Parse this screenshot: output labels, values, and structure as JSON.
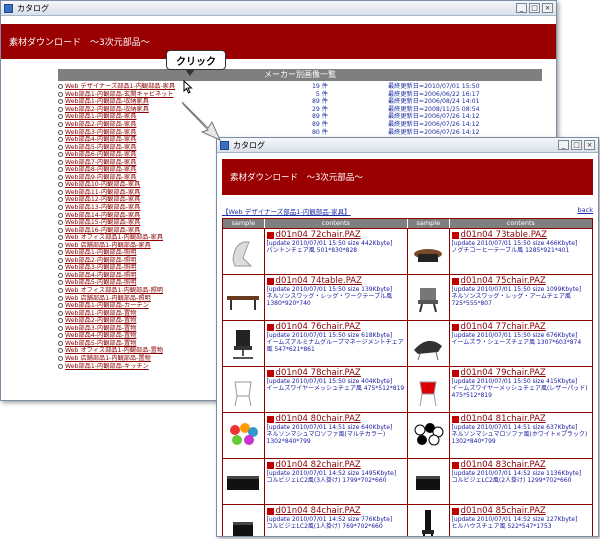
{
  "window1": {
    "title": "カタログ",
    "banner": "素材ダウンロード　～3次元部品～",
    "table_header": "メーカー別画像一覧",
    "rows": [
      {
        "label": "Web デザイナーズ部品1-内観部品-家具",
        "count": "19 件",
        "updated": "最終更新日=2010/07/01 15:50"
      },
      {
        "label": "Web部品1-内観部品-玄関キャビネット",
        "count": "5 件",
        "updated": "最終更新日=2006/06/22 16:17"
      },
      {
        "label": "Web部品1-内観部品-収納家具",
        "count": "89 件",
        "updated": "最終更新日=2006/08/24 14:01"
      },
      {
        "label": "Web部品2-内観部品-収納家具",
        "count": "29 件",
        "updated": "最終更新日=2008/11/25 08:54"
      },
      {
        "label": "Web部品1-内観部品-家具",
        "count": "89 件",
        "updated": "最終更新日=2006/07/26 14:12"
      },
      {
        "label": "Web部品2-内観部品-家具",
        "count": "89 件",
        "updated": "最終更新日=2006/07/26 14:12"
      },
      {
        "label": "Web部品3-内観部品-家具",
        "count": "80 件",
        "updated": "最終更新日=2006/07/26 14:12"
      },
      {
        "label": "Web部品4-内観部品-家具",
        "count": "",
        "updated": ""
      },
      {
        "label": "Web部品5-内観部品-家具",
        "count": "",
        "updated": ""
      },
      {
        "label": "Web部品6-内観部品-家具",
        "count": "",
        "updated": ""
      },
      {
        "label": "Web部品7-内観部品-家具",
        "count": "",
        "updated": ""
      },
      {
        "label": "Web部品8-内観部品-家具",
        "count": "",
        "updated": ""
      },
      {
        "label": "Web部品9-内観部品-家具",
        "count": "",
        "updated": ""
      },
      {
        "label": "Web部品10-内観部品-家具",
        "count": "",
        "updated": ""
      },
      {
        "label": "Web部品11-内観部品-家具",
        "count": "",
        "updated": ""
      },
      {
        "label": "Web部品12-内観部品-家具",
        "count": "",
        "updated": ""
      },
      {
        "label": "Web部品13-内観部品-家具",
        "count": "",
        "updated": ""
      },
      {
        "label": "Web部品14-内観部品-家具",
        "count": "",
        "updated": ""
      },
      {
        "label": "Web部品15-内観部品-家具",
        "count": "",
        "updated": ""
      },
      {
        "label": "Web部品16-内観部品-家具",
        "count": "",
        "updated": ""
      },
      {
        "label": "Web オフィス部品1-内観部品-家具",
        "count": "",
        "updated": ""
      },
      {
        "label": "Web 店舗部品1-内観部品-家具",
        "count": "",
        "updated": ""
      },
      {
        "label": "Web部品1-内観部品-照明",
        "count": "",
        "updated": ""
      },
      {
        "label": "Web部品2-内観部品-照明",
        "count": "",
        "updated": ""
      },
      {
        "label": "Web部品3-内観部品-照明",
        "count": "",
        "updated": ""
      },
      {
        "label": "Web部品4-内観部品-照明",
        "count": "",
        "updated": ""
      },
      {
        "label": "Web部品5-内観部品-照明",
        "count": "",
        "updated": ""
      },
      {
        "label": "Web オフィス部品1-内観部品-照明",
        "count": "",
        "updated": ""
      },
      {
        "label": "Web 店舗部品1-内観部品-照明",
        "count": "",
        "updated": ""
      },
      {
        "label": "Web部品1-内観部品-カーテン",
        "count": "",
        "updated": ""
      },
      {
        "label": "Web部品1-内観部品-置物",
        "count": "",
        "updated": ""
      },
      {
        "label": "Web部品2-内観部品-置物",
        "count": "",
        "updated": ""
      },
      {
        "label": "Web部品3-内観部品-置物",
        "count": "",
        "updated": ""
      },
      {
        "label": "Web部品4-内観部品-置物",
        "count": "",
        "updated": ""
      },
      {
        "label": "Web部品5-内観部品-置物",
        "count": "",
        "updated": ""
      },
      {
        "label": "Web オフィス部品1-内観部品-置物",
        "count": "",
        "updated": ""
      },
      {
        "label": "Web 店舗部品1-内観部品-置物",
        "count": "",
        "updated": ""
      },
      {
        "label": "Web部品1-内観部品-キッチン",
        "count": "",
        "updated": ""
      }
    ]
  },
  "callout": "クリック",
  "window2": {
    "title": "カタログ",
    "banner": "素材ダウンロード　～3次元部品～",
    "section_title": "【Web デザイナーズ部品1-内観部品-家具】",
    "back_link": "back",
    "col_sample": "sample",
    "col_contents": "contents",
    "items": [
      {
        "name": "d01n04 72chair.PAZ",
        "meta": "[update 2010/07/01 15:50 size 442Kbyte]",
        "desc": "パントンチェア風 501*830*828"
      },
      {
        "name": "d01n04 73table.PAZ",
        "meta": "[update 2010/07/01 15:50 size 466Kbyte]",
        "desc": "ノグチコーヒーテーブル風 1285*921*401"
      },
      {
        "name": "d01n04 74table.PAZ",
        "meta": "[update 2010/07/01 15:50 size 139Kbyte]",
        "desc": "ネルソンスワッグ・レッグ・ワークテーブル風 1380*920*740"
      },
      {
        "name": "d01n04 75chair.PAZ",
        "meta": "[update 2010/07/01 15:50 size 1099Kbyte]",
        "desc": "ネルソンスワッグ・レッグ・アームチェア風 725*555*807"
      },
      {
        "name": "d01n04 76chair.PAZ",
        "meta": "[update 2010/07/01 15:50 size 618Kbyte]",
        "desc": "イームズアルミナムグループマネージメントチェア風 547*621*861"
      },
      {
        "name": "d01n04 77chair.PAZ",
        "meta": "[update 2010/07/01 15:50 size 676Kbyte]",
        "desc": "イームズラ・シェーズチェア風 1307*603*874"
      },
      {
        "name": "d01n04 78chair.PAZ",
        "meta": "[update 2010/07/01 15:50 size 404Kbyte]",
        "desc": "イームズワイヤーメッシュチェア風 475*512*819"
      },
      {
        "name": "d01n04 79chair.PAZ",
        "meta": "[update 2010/07/01 15:50 size 415Kbyte]",
        "desc": "イームズワイヤーメッシュチェア風(レザーパッド) 475*512*819"
      },
      {
        "name": "d01n04 80chair.PAZ",
        "meta": "[update 2010/07/01 14:51 size 640Kbyte]",
        "desc": "ネルソンマシュマロソファ風(マルチカラー) 1302*840*799"
      },
      {
        "name": "d01n04 81chair.PAZ",
        "meta": "[update 2010/07/01 14:51 size 637Kbyte]",
        "desc": "ネルソンマシュマロソファ風(ホワイト×ブラック) 1302*840*799"
      },
      {
        "name": "d01n04 82chair.PAZ",
        "meta": "[update 2010/07/01 14:52 size 1495Kbyte]",
        "desc": "コルビジェLC2風(3人掛け) 1799*702*660"
      },
      {
        "name": "d01n04 83chair.PAZ",
        "meta": "[update 2010/07/01 14:52 size 1136Kbyte]",
        "desc": "コルビジェLC2風(2人掛け) 1299*702*660"
      },
      {
        "name": "d01n04 84chair.PAZ",
        "meta": "[update 2010/07/01 14:52 size 776Kbyte]",
        "desc": "コルビジェLC2風(1人掛け) 769*702*660"
      },
      {
        "name": "d01n04 85chair.PAZ",
        "meta": "[update 2010/07/01 14:52 size 127Kbyte]",
        "desc": "ヒルハウスチェア風 522*547*1753"
      }
    ]
  },
  "colors": {
    "banner": "#9a0000",
    "link": "#8a0000",
    "text": "#1e2fa0",
    "header": "#7f7f7f"
  }
}
